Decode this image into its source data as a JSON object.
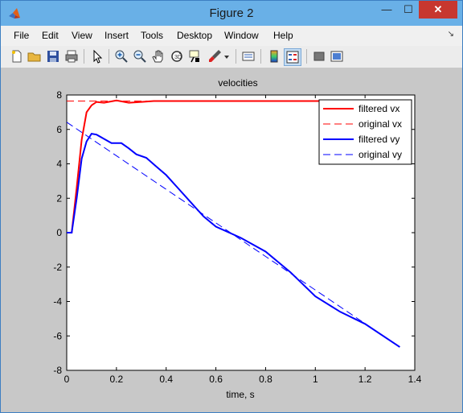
{
  "window": {
    "title": "Figure 2",
    "minimize_glyph": "—",
    "maximize_glyph": "☐",
    "close_glyph": "✕"
  },
  "menus": [
    "File",
    "Edit",
    "View",
    "Insert",
    "Tools",
    "Desktop",
    "Window",
    "Help"
  ],
  "menu_dock_glyph": "↘",
  "toolbar": [
    "new-figure",
    "open-file",
    "save-figure",
    "print-figure",
    "edit-plot",
    "zoom-in",
    "zoom-out",
    "pan",
    "rotate-3d",
    "data-cursor",
    "brush",
    "brush-dropdown",
    "link-plot",
    "insert-colorbar",
    "insert-legend",
    "hide-plot-tools",
    "show-plot-tools"
  ],
  "colors": {
    "red": "#ff0000",
    "blue": "#0000ff",
    "axes_bg": "#ffffff",
    "figure_bg": "#c8c8c8"
  },
  "chart_data": {
    "type": "line",
    "title": "velocities",
    "xlabel": "time, s",
    "ylabel": "",
    "xlim": [
      0,
      1.4
    ],
    "ylim": [
      -8,
      8
    ],
    "xticks": [
      0,
      0.2,
      0.4,
      0.6,
      0.8,
      1,
      1.2,
      1.4
    ],
    "yticks": [
      -8,
      -6,
      -4,
      -2,
      0,
      2,
      4,
      6,
      8
    ],
    "legend_position": "top-right",
    "series": [
      {
        "name": "filtered vx",
        "color": "#ff0000",
        "style": "solid",
        "x": [
          0,
          0.02,
          0.04,
          0.06,
          0.08,
          0.1,
          0.12,
          0.15,
          0.2,
          0.25,
          0.3,
          0.35,
          0.4,
          1.34
        ],
        "y": [
          0,
          0,
          2.6,
          5.4,
          7.0,
          7.4,
          7.6,
          7.55,
          7.68,
          7.55,
          7.6,
          7.65,
          7.65,
          7.65
        ]
      },
      {
        "name": "original vx",
        "color": "#ff0000",
        "style": "dashed",
        "x": [
          0,
          1.34
        ],
        "y": [
          7.65,
          7.65
        ]
      },
      {
        "name": "filtered vy",
        "color": "#0000ff",
        "style": "solid",
        "x": [
          0,
          0.02,
          0.04,
          0.06,
          0.08,
          0.1,
          0.12,
          0.15,
          0.18,
          0.22,
          0.25,
          0.28,
          0.32,
          0.36,
          0.4,
          0.45,
          0.5,
          0.55,
          0.6,
          0.7,
          0.8,
          0.9,
          1.0,
          1.1,
          1.2,
          1.34
        ],
        "y": [
          0,
          0,
          2.0,
          4.3,
          5.3,
          5.75,
          5.7,
          5.45,
          5.2,
          5.2,
          4.9,
          4.55,
          4.35,
          3.85,
          3.35,
          2.55,
          1.75,
          0.95,
          0.35,
          -0.3,
          -1.1,
          -2.3,
          -3.7,
          -4.6,
          -5.3,
          -6.65
        ]
      },
      {
        "name": "original vy",
        "color": "#0000ff",
        "style": "dashed",
        "x": [
          0,
          1.34
        ],
        "y": [
          6.42,
          -6.65
        ]
      }
    ]
  }
}
